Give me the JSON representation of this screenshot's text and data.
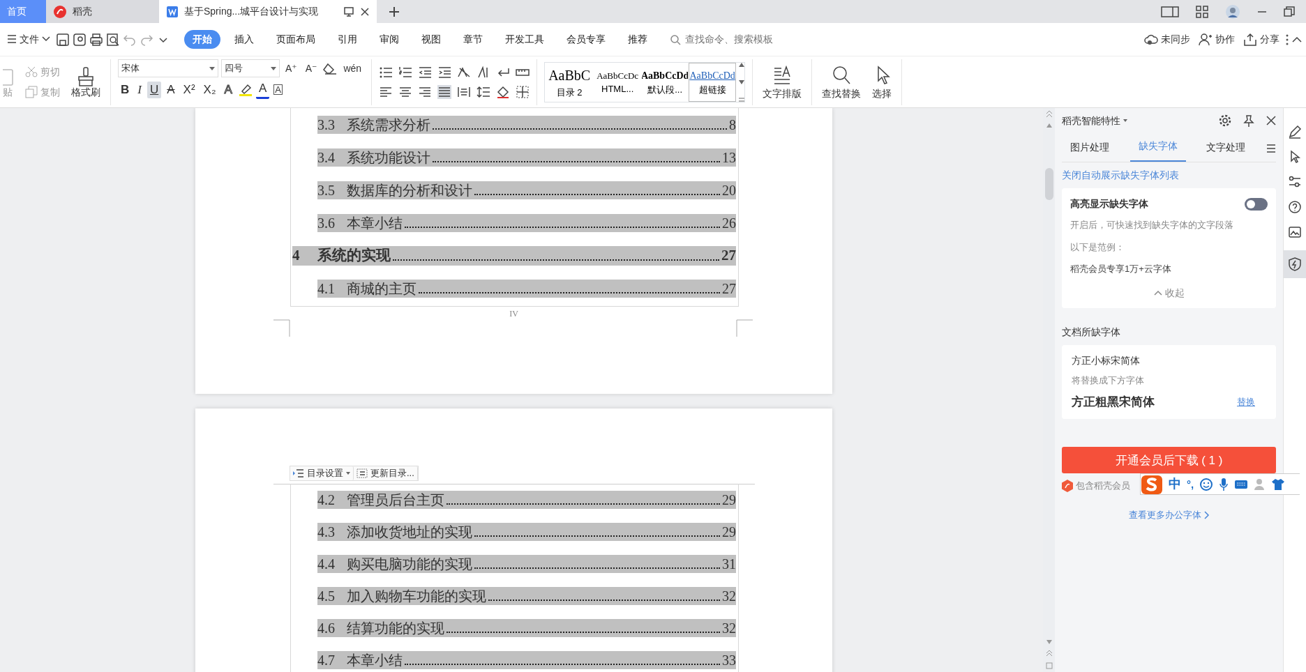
{
  "tabs": [
    {
      "label": "首页",
      "kind": "home",
      "selected": false
    },
    {
      "label": "稻壳",
      "kind": "docer",
      "selected": false
    },
    {
      "label": "基于Spring...城平台设计与实现",
      "kind": "doc",
      "selected": true
    }
  ],
  "menu": {
    "file": "文件",
    "tabs": [
      {
        "label": "开始",
        "selected": true
      },
      {
        "label": "插入",
        "selected": false
      },
      {
        "label": "页面布局",
        "selected": false
      },
      {
        "label": "引用",
        "selected": false
      },
      {
        "label": "审阅",
        "selected": false
      },
      {
        "label": "视图",
        "selected": false
      },
      {
        "label": "章节",
        "selected": false
      },
      {
        "label": "开发工具",
        "selected": false
      },
      {
        "label": "会员专享",
        "selected": false
      },
      {
        "label": "推荐",
        "selected": false
      }
    ],
    "search": {
      "placeholder": "查找命令、搜索模板"
    },
    "actions": [
      {
        "label": "未同步",
        "kind": "cloud"
      },
      {
        "label": "协作",
        "kind": "person"
      },
      {
        "label": "分享",
        "kind": "share"
      }
    ]
  },
  "ribbon": {
    "paste": "贴",
    "cut": "剪切",
    "copy": "复制",
    "format_painter": "格式刷",
    "font_name": "宋体",
    "font_size": "四号",
    "size_tools": [
      "A⁺",
      "A⁻"
    ],
    "phonetic": "wén",
    "format_tools": [
      {
        "label": "B",
        "kind": "bold",
        "selected": false
      },
      {
        "label": "I",
        "kind": "italic",
        "selected": false
      },
      {
        "label": "U",
        "kind": "underline",
        "selected": true
      },
      {
        "label": "A",
        "kind": "strike",
        "selected": false
      },
      {
        "label": "X²",
        "kind": "plain",
        "selected": false
      },
      {
        "label": "X₂",
        "kind": "plain",
        "selected": false
      },
      {
        "label": "A",
        "kind": "outline",
        "selected": false
      },
      {
        "label": "A",
        "kind": "color",
        "selected": false
      },
      {
        "label": "A",
        "kind": "boxed",
        "selected": false
      }
    ],
    "styles": [
      {
        "preview": "AaBbC",
        "label": "目录 2",
        "kind": "large"
      },
      {
        "preview": "AaBbCcDc",
        "label": "HTML...",
        "kind": "normal"
      },
      {
        "preview": "AaBbCcDd",
        "label": "默认段...",
        "kind": "bold"
      },
      {
        "preview": "AaBbCcDd",
        "label": "超链接",
        "kind": "link"
      }
    ],
    "text_layout": "文字排版",
    "find_replace": "查找替换",
    "select": "选择"
  },
  "document": {
    "pages": [
      {
        "page_number": "IV",
        "entries": [
          {
            "number": "3.3",
            "title": "系统需求分析",
            "page": "8",
            "kind": "section"
          },
          {
            "number": "3.4",
            "title": "系统功能设计",
            "page": "13",
            "kind": "section"
          },
          {
            "number": "3.5",
            "title": "数据库的分析和设计",
            "page": "20",
            "kind": "section"
          },
          {
            "number": "3.6",
            "title": "本章小结",
            "page": "26",
            "kind": "section"
          },
          {
            "number": "4",
            "title": "系统的实现",
            "page": "27",
            "kind": "chapter"
          },
          {
            "number": "4.1",
            "title": "商城的主页",
            "page": "27",
            "kind": "section"
          }
        ]
      },
      {
        "toc_toolbar": [
          "目录设置",
          "更新目录..."
        ],
        "entries": [
          {
            "number": "4.2",
            "title": "管理员后台主页",
            "page": "29",
            "kind": "section"
          },
          {
            "number": "4.3",
            "title": "添加收货地址的实现",
            "page": "29",
            "kind": "section"
          },
          {
            "number": "4.4",
            "title": "购买电脑功能的实现",
            "page": "31",
            "kind": "section"
          },
          {
            "number": "4.5",
            "title": "加入购物车功能的实现",
            "page": "32",
            "kind": "section"
          },
          {
            "number": "4.6",
            "title": "结算功能的实现",
            "page": "32",
            "kind": "section"
          },
          {
            "number": "4.7",
            "title": "本章小结",
            "page": "33",
            "kind": "section"
          }
        ]
      }
    ]
  },
  "panel": {
    "title": "稻壳智能特性",
    "tabs": [
      {
        "label": "图片处理",
        "selected": false
      },
      {
        "label": "缺失字体",
        "selected": true
      },
      {
        "label": "文字处理",
        "selected": false
      }
    ],
    "close_link": "关闭自动展示缺失字体列表",
    "highlight_card": {
      "title": "高亮显示缺失字体",
      "on": false,
      "lines": [
        "开启后，可快速找到缺失字体的文字段落",
        "以下是范例：",
        "稻壳会员专享1万+云字体"
      ],
      "collapse": "收起"
    },
    "missing_heading": "文档所缺字体",
    "font_card": {
      "missing": "方正小标宋简体",
      "note": "将替换成下方字体",
      "replacement": "方正粗黑宋简体",
      "replace_link": "替换"
    },
    "download_button": "开通会员后下载 ( 1 )",
    "included_note": "包含稻壳会员",
    "more_link": "查看更多办公字体"
  },
  "ime": {
    "mode": "中",
    "punctuation": "°,"
  }
}
